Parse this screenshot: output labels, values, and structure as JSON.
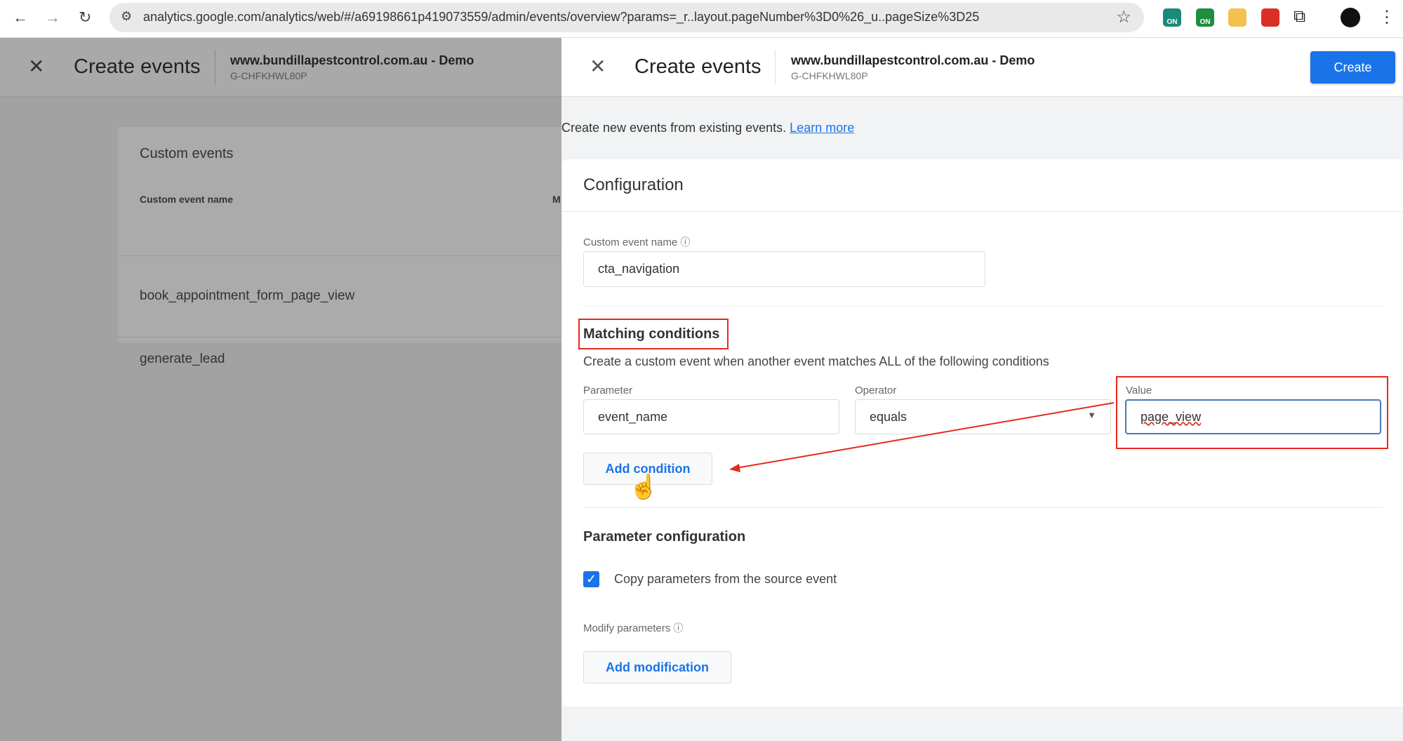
{
  "browser": {
    "url": "analytics.google.com/analytics/web/#/a69198661p419073559/admin/events/overview?params=_r..layout.pageNumber%3D0%26_u..pageSize%3D25",
    "ext_badge": "ON"
  },
  "background_panel": {
    "title": "Create events",
    "site": "www.bundillapestcontrol.com.au - Demo",
    "property_id": "G-CHFKHWL80P",
    "card_title": "Custom events",
    "column_header": "Custom event name",
    "column_header_2": "M",
    "rows": [
      "book_appointment_form_page_view",
      "generate_lead"
    ]
  },
  "panel": {
    "title": "Create events",
    "site": "www.bundillapestcontrol.com.au - Demo",
    "property_id": "G-CHFKHWL80P",
    "create_label": "Create",
    "intro": "Create new events from existing events.",
    "learn_more": "Learn more",
    "config_title": "Configuration",
    "custom_event_name_label": "Custom event name",
    "custom_event_name_value": "cta_navigation",
    "matching_title": "Matching conditions",
    "matching_desc": "Create a custom event when another event matches ALL of the following conditions",
    "parameter_label": "Parameter",
    "parameter_value": "event_name",
    "operator_label": "Operator",
    "operator_value": "equals",
    "value_label": "Value",
    "value_value": "page_view",
    "add_condition": "Add condition",
    "param_config_title": "Parameter configuration",
    "copy_params_label": "Copy parameters from the source event",
    "copy_params_checked": true,
    "modify_label": "Modify parameters",
    "add_modification": "Add modification"
  },
  "colors": {
    "accent": "#1a73e8",
    "annotation": "#e8281e"
  }
}
